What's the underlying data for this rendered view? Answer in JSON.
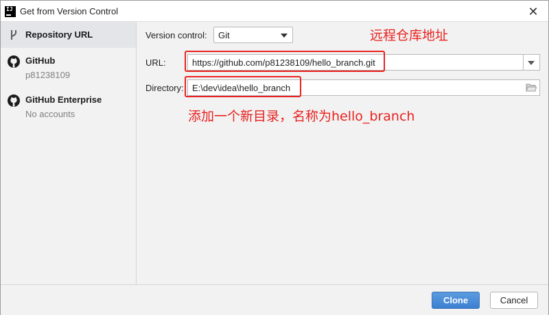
{
  "window": {
    "title": "Get from Version Control",
    "app_icon_text": "IJ"
  },
  "sidebar": {
    "items": [
      {
        "title": "Repository URL",
        "subtitle": "",
        "icon": "vcs-branch-icon",
        "selected": true
      },
      {
        "title": "GitHub",
        "subtitle": "p81238109",
        "icon": "github-icon",
        "selected": false
      },
      {
        "title": "GitHub Enterprise",
        "subtitle": "No accounts",
        "icon": "github-icon",
        "selected": false
      }
    ]
  },
  "form": {
    "version_control_label": "Version control:",
    "version_control_value": "Git",
    "url_label": "URL:",
    "url_value": "https://github.com/p81238109/hello_branch.git",
    "directory_label": "Directory:",
    "directory_value": "E:\\dev\\idea\\hello_branch"
  },
  "annotations": {
    "remote_repo": "远程仓库地址",
    "new_dir": "添加一个新目录，名称为hello_branch"
  },
  "footer": {
    "clone_label": "Clone",
    "cancel_label": "Cancel"
  },
  "colors": {
    "annotation_red": "#e8211e",
    "primary_button": "#4a8dd8",
    "selected_item_bg": "#e3e5e8"
  }
}
